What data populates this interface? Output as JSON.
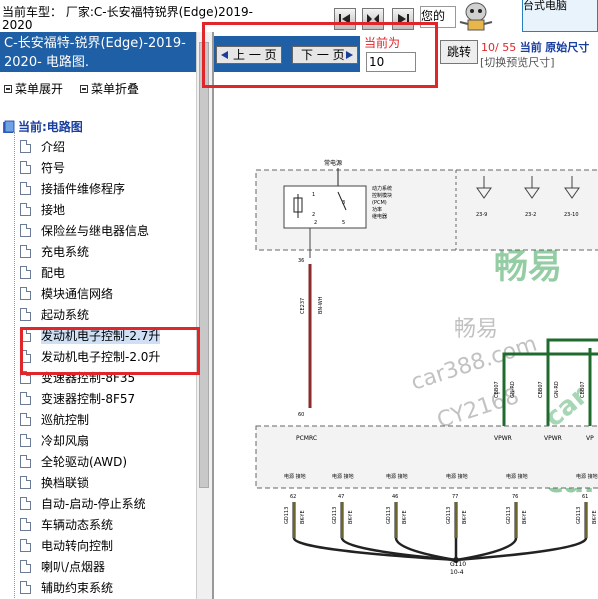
{
  "header": {
    "vehicle_label": "当前车型： 厂家:C-长安福特锐界(Edge)2019-2020",
    "welcome_text": "您的",
    "promo_text": "台式电脑"
  },
  "left_panel": {
    "title": "C-长安福特-锐界(Edge)-2019-2020- 电路图.",
    "expand_label": "菜单展开",
    "collapse_label": "菜单折叠",
    "root_label": "当前:电路图",
    "items": [
      "介绍",
      "符号",
      "接插件维修程序",
      "接地",
      "保险丝与继电器信息",
      "充电系统",
      "配电",
      "模块通信网络",
      "起动系统",
      "发动机电子控制-2.7升",
      "发动机电子控制-2.0升",
      "变速器控制-8F35",
      "变速器控制-8F57",
      "巡航控制",
      "冷却风扇",
      "全轮驱动(AWD)",
      "换档联锁",
      "自动-启动-停止系统",
      "车辆动态系统",
      "电动转向控制",
      "喇叭/点烟器",
      "辅助约束系统"
    ],
    "selected_index": 9
  },
  "toolbar": {
    "prev_label": "上 一 页",
    "next_label": "下 一 页",
    "current_label": "当前为",
    "page_value": "10",
    "jump_label": "跳转",
    "page_current": "10",
    "page_total": "/ 55",
    "current_word": "当前",
    "size_label": "原始尺寸",
    "resize_hint": "[切换预览尺寸]"
  },
  "diagram": {
    "power_label": "常电源",
    "pcm_label_1": "动力系统",
    "pcm_label_2": "控制模块",
    "pcm_label_3": "(PCM)",
    "pcm_label_4": "功率",
    "pcm_label_5": "继电器",
    "pin_1": "1",
    "pin_2": "2",
    "pin_3": "3",
    "pin_5": "5",
    "ref_1": "23-9",
    "ref_2": "23-2",
    "ref_3": "23-10",
    "wire_pin_top": "36",
    "wire_code": "CE237",
    "wire_color": "BN-WH",
    "wire_pin_bottom": "60",
    "green_1": "CBB07",
    "green_2": "GN-RD",
    "green_3": "CBB07",
    "green_4": "GN-RD",
    "green_5": "CBB07",
    "pcmrc_label": "PCMRC",
    "vpwr_1": "VPWR",
    "vpwr_2": "VPWR",
    "vpwr_3": "VP",
    "gnd_label": "电源 接地",
    "gnd_pins": [
      "62",
      "47",
      "46",
      "77",
      "76",
      "61"
    ],
    "gnd_code": "GD113",
    "gnd_color": "BK-YE",
    "ground_ref": "G110",
    "ground_page": "10-4",
    "watermark_1": "畅易",
    "watermark_2": "畅易",
    "watermark_3": "car388.com",
    "watermark_4": "CY2168",
    "watermark_5": "car",
    "watermark_6": "car"
  }
}
